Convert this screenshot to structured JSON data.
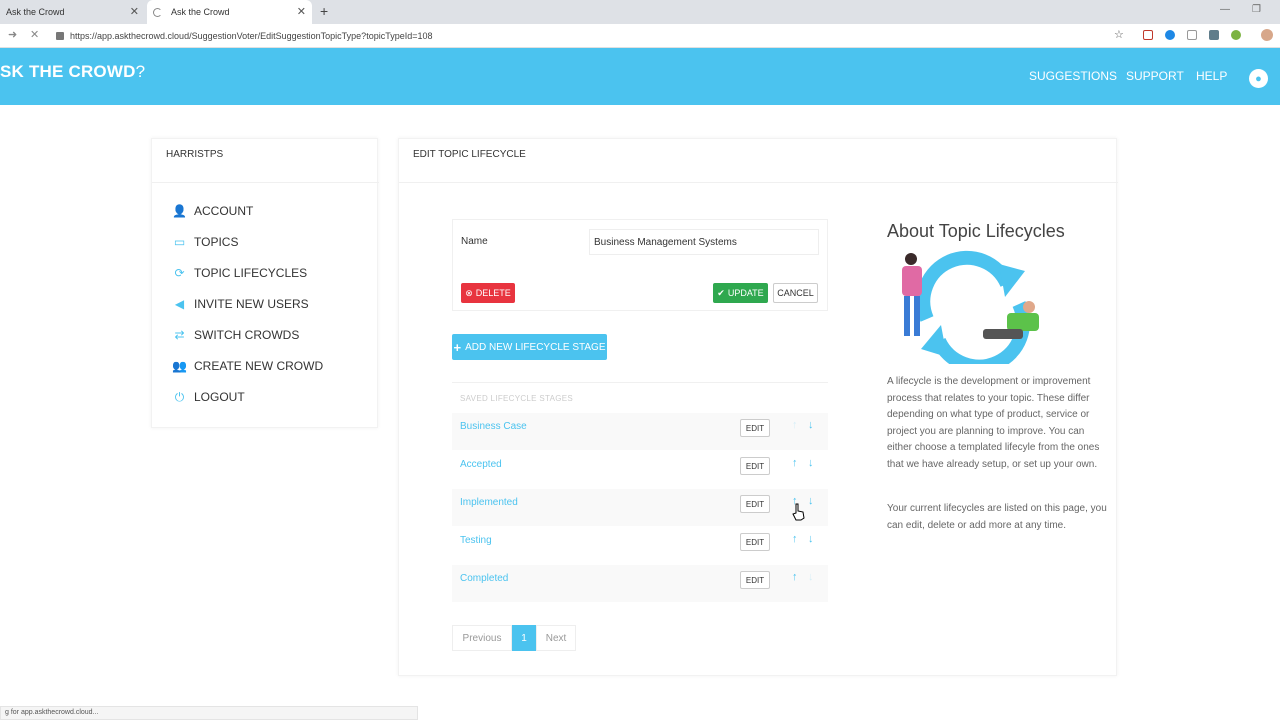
{
  "browser": {
    "tabs": [
      {
        "title": "Ask the Crowd"
      },
      {
        "title": "Ask the Crowd"
      }
    ],
    "url": "https://app.askthecrowd.cloud/SuggestionVoter/EditSuggestionTopicType?topicTypeId=108",
    "status_text": "g for app.askthecrowd.cloud..."
  },
  "header": {
    "logo": "SK THE CROWD",
    "nav": [
      "SUGGESTIONS",
      "SUPPORT",
      "HELP"
    ]
  },
  "sidebar": {
    "heading": "HARRISTPS",
    "items": [
      {
        "label": "ACCOUNT",
        "icon": "user-icon"
      },
      {
        "label": "TOPICS",
        "icon": "comment-icon"
      },
      {
        "label": "TOPIC LIFECYCLES",
        "icon": "refresh-icon"
      },
      {
        "label": "INVITE NEW USERS",
        "icon": "megaphone-icon"
      },
      {
        "label": "SWITCH CROWDS",
        "icon": "exchange-icon"
      },
      {
        "label": "CREATE NEW CROWD",
        "icon": "users-icon"
      },
      {
        "label": "LOGOUT",
        "icon": "power-icon"
      }
    ]
  },
  "main": {
    "heading": "EDIT TOPIC LIFECYCLE",
    "name_label": "Name",
    "name_value": "Business Management Systems",
    "delete_label": "DELETE",
    "update_label": "UPDATE",
    "cancel_label": "CANCEL",
    "add_stage_label": "ADD NEW LIFECYCLE STAGE",
    "saved_title": "SAVED LIFECYCLE STAGES",
    "stages": [
      {
        "name": "Business Case",
        "edit": "EDIT"
      },
      {
        "name": "Accepted",
        "edit": "EDIT"
      },
      {
        "name": "Implemented",
        "edit": "EDIT"
      },
      {
        "name": "Testing",
        "edit": "EDIT"
      },
      {
        "name": "Completed",
        "edit": "EDIT"
      }
    ],
    "pager": {
      "prev": "Previous",
      "current": "1",
      "next": "Next"
    }
  },
  "about": {
    "title": "About Topic Lifecycles",
    "para1": "A lifecycle is the development or improvement process that relates to your topic. These differ depending on what type of product, service or project you are planning to improve. You can either choose a templated lifecyle from the ones that we have already setup, or set up your own.",
    "para2": "Your current lifecycles are listed on this page, you can edit, delete or add more at any time."
  },
  "colors": {
    "brand": "#4bc3ef",
    "danger": "#e8343f",
    "success": "#2fa84f"
  }
}
